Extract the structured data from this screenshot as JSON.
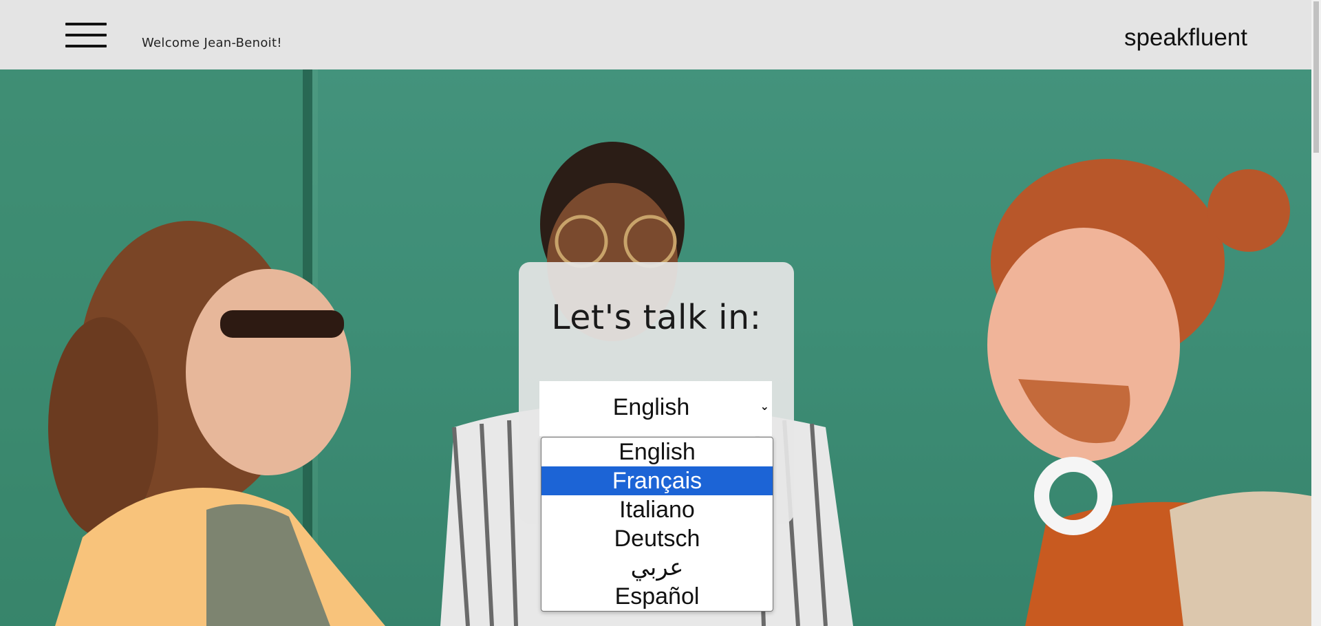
{
  "header": {
    "welcome_text": "Welcome Jean-Benoit!",
    "brand": "speakfluent",
    "menu_icon": "hamburger-menu-icon"
  },
  "card": {
    "title": "Let's talk in:",
    "select_value": "English",
    "select_icon": "chevron-down-icon"
  },
  "dropdown": {
    "options": [
      {
        "label": "English"
      },
      {
        "label": "Français"
      },
      {
        "label": "Italiano"
      },
      {
        "label": "Deutsch"
      },
      {
        "label": "عربي"
      },
      {
        "label": "Español"
      }
    ],
    "highlighted_label": "Français"
  },
  "colors": {
    "header_bg": "#e4e4e4",
    "wall_green": "#3f8a70",
    "highlight_blue": "#1c64d6"
  }
}
